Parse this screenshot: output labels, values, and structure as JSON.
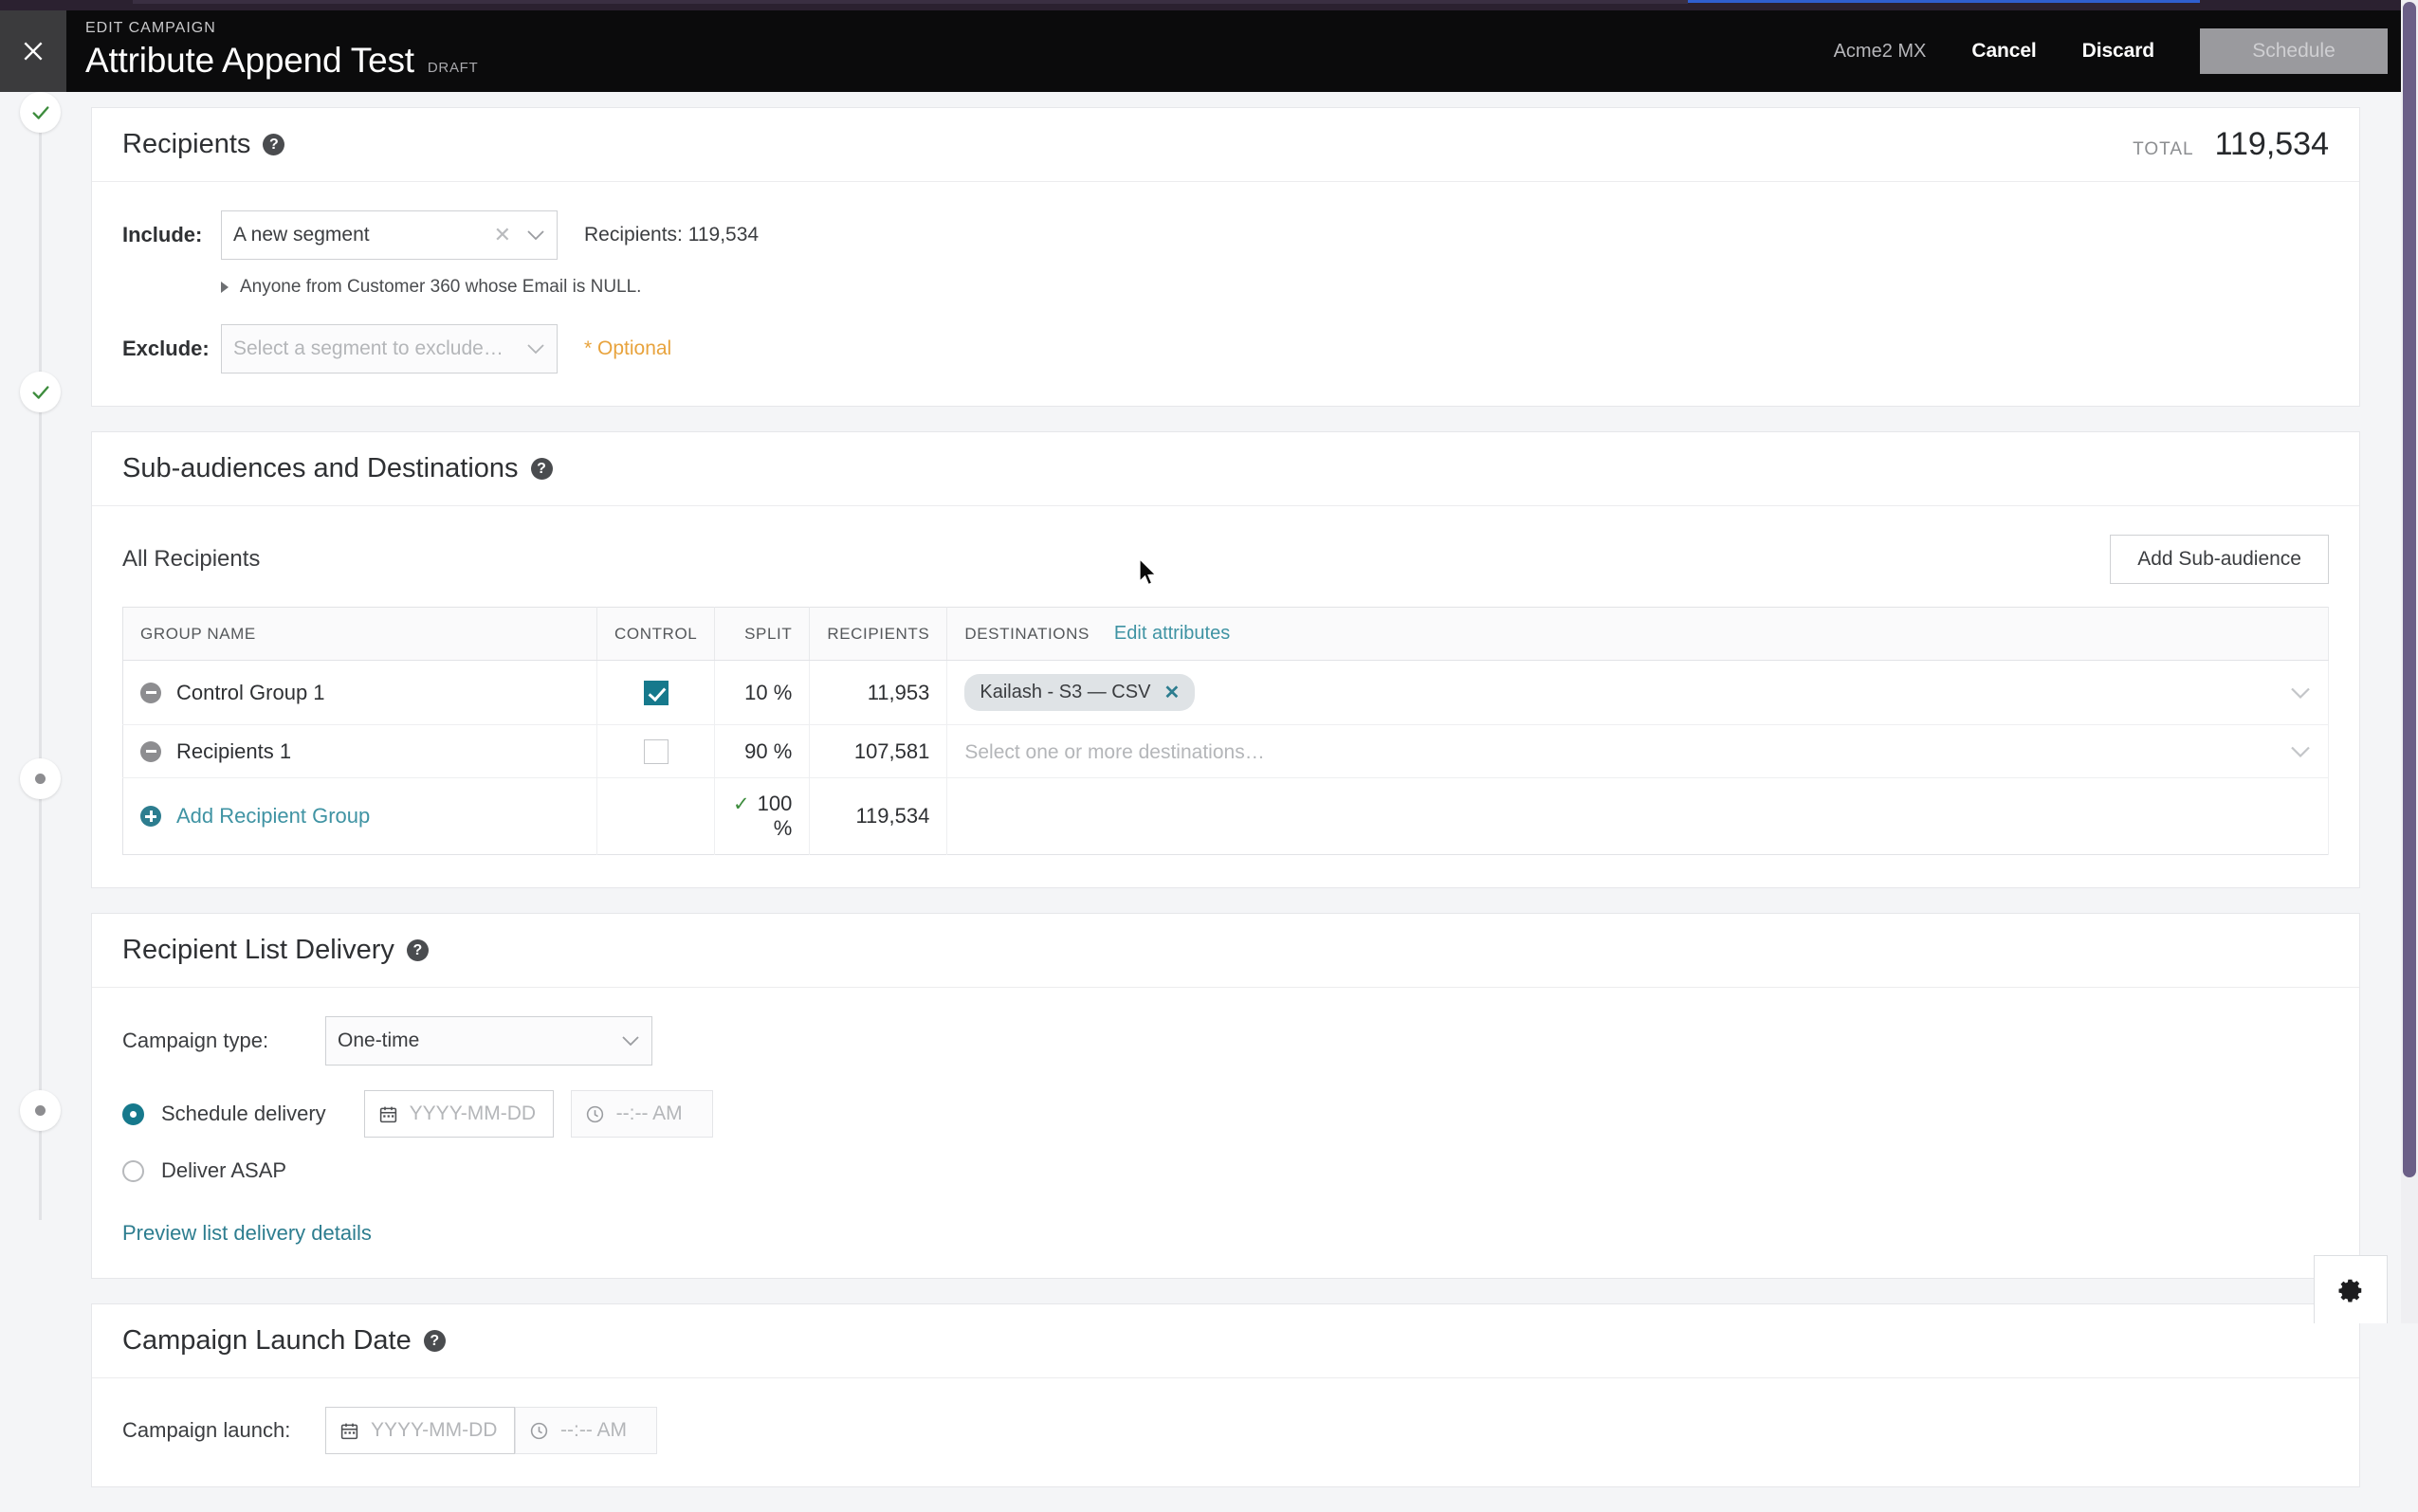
{
  "appbar": {
    "close_icon": "close-icon",
    "eyebrow": "EDIT CAMPAIGN",
    "title": "Attribute Append Test",
    "status": "DRAFT",
    "org": "Acme2 MX",
    "cancel": "Cancel",
    "discard": "Discard",
    "schedule": "Schedule"
  },
  "stepper": {
    "steps": [
      {
        "state": "complete",
        "icon": "check-icon"
      },
      {
        "state": "complete",
        "icon": "check-icon"
      },
      {
        "state": "pending",
        "icon": "dot-icon"
      },
      {
        "state": "pending",
        "icon": "dot-icon"
      }
    ]
  },
  "recipients": {
    "title": "Recipients",
    "help_icon": "help-icon",
    "total_label": "TOTAL",
    "total_value": "119,534",
    "include_label": "Include:",
    "include_value": "A new segment",
    "include_clear_icon": "clear-icon",
    "include_count": "Recipients: 119,534",
    "segment_description": "Anyone from Customer 360 whose Email is NULL.",
    "exclude_label": "Exclude:",
    "exclude_placeholder": "Select a segment to exclude…",
    "exclude_optional": "* Optional"
  },
  "subaudiences": {
    "title": "Sub-audiences and Destinations",
    "help_icon": "help-icon",
    "all_recipients": "All Recipients",
    "add_subaudience": "Add Sub-audience",
    "columns": {
      "group": "GROUP NAME",
      "control": "CONTROL",
      "split": "SPLIT",
      "recipients": "RECIPIENTS",
      "destinations": "DESTINATIONS"
    },
    "edit_attributes": "Edit attributes",
    "rows": [
      {
        "name": "Control Group 1",
        "control_checked": true,
        "split": "10 %",
        "recipients": "11,953",
        "destination_pill": "Kailash - S3 — CSV",
        "destination_placeholder": ""
      },
      {
        "name": "Recipients 1",
        "control_checked": false,
        "split": "90 %",
        "recipients": "107,581",
        "destination_pill": "",
        "destination_placeholder": "Select one or more destinations…"
      }
    ],
    "add_group": "Add Recipient Group",
    "total_split": "100 %",
    "total_recipients": "119,534"
  },
  "delivery": {
    "title": "Recipient List Delivery",
    "help_icon": "help-icon",
    "campaign_type_label": "Campaign type:",
    "campaign_type_value": "One-time",
    "schedule_radio_label": "Schedule delivery",
    "schedule_selected": true,
    "date_placeholder": "YYYY-MM-DD",
    "time_placeholder": "--:-- AM",
    "asap_radio_label": "Deliver ASAP",
    "preview_link": "Preview list delivery details"
  },
  "launch": {
    "title": "Campaign Launch Date",
    "help_icon": "help-icon",
    "label": "Campaign launch:",
    "date_placeholder": "YYYY-MM-DD",
    "time_placeholder": "--:-- AM"
  },
  "footer": {
    "gear_icon": "gear-icon"
  },
  "colors": {
    "teal": "#2d7d8f",
    "amber": "#e8a33d",
    "green": "#3d8c3d",
    "appbar": "#0b0b0c",
    "scrollbar": "#6b5f87"
  }
}
